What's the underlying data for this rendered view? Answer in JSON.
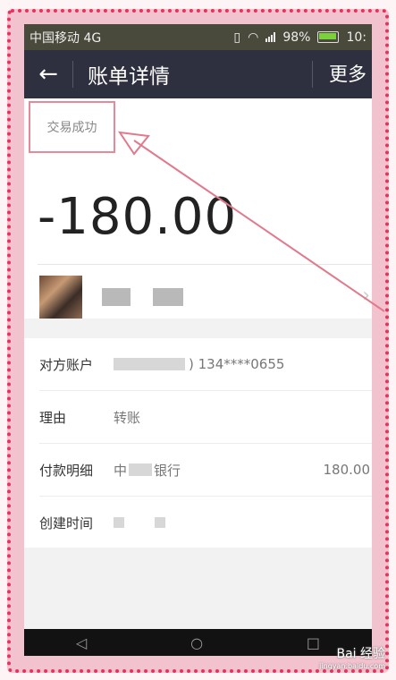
{
  "status_bar": {
    "carrier": "中国移动 4G",
    "battery_pct": "98%",
    "time": "10:"
  },
  "header": {
    "back_icon": "arrow-left-icon",
    "title": "账单详情",
    "more_label": "更多"
  },
  "bill": {
    "status": "交易成功",
    "amount": "-180.00"
  },
  "details": [
    {
      "label": "对方账户",
      "value": ") 134****0655"
    },
    {
      "label": "理由",
      "value": "转账"
    },
    {
      "label": "付款明细",
      "value_left": "中",
      "value_mid": "银行",
      "value_right": "180.00"
    },
    {
      "label": "创建时间",
      "value": ""
    }
  ],
  "watermark": {
    "brand": "Bai  经验",
    "url": "jingyan.baidu.com"
  },
  "colors": {
    "header_bg": "#2e3040",
    "highlight": "#e58a99",
    "frame": "#e8325a"
  }
}
